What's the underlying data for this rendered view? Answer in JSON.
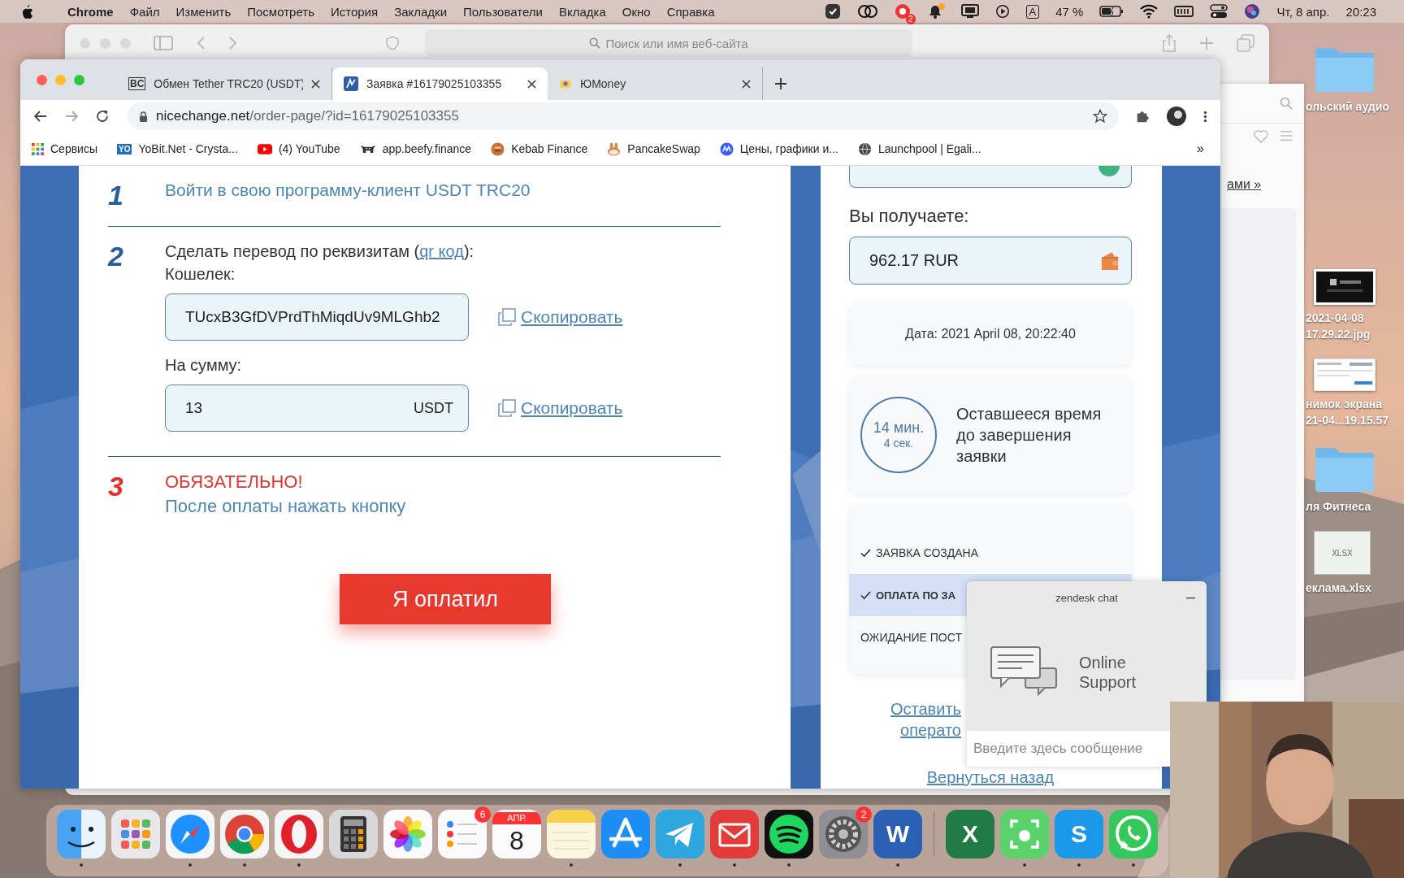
{
  "menu_bar": {
    "app": "Chrome",
    "menus": [
      "Файл",
      "Изменить",
      "Посмотреть",
      "История",
      "Закладки",
      "Пользователи",
      "Вкладка",
      "Окно",
      "Справка"
    ],
    "status_badge": "2",
    "input_source": "A",
    "battery": "47 %",
    "date": "Чт, 8 апр.",
    "time": "20:23"
  },
  "background_window": {
    "search_placeholder": "Поиск или имя веб-сайта"
  },
  "side_window": {
    "link": "ами »"
  },
  "desktop_icons": [
    {
      "kind": "folder",
      "lines": [
        "ольский аудио"
      ]
    },
    {
      "lines": [
        "2021-04-08",
        "17.29.22.jpg"
      ]
    },
    {
      "kind": "screenshot",
      "lines": [
        "нимок экрана",
        "21-04...19.15.57"
      ]
    },
    {
      "kind": "folder",
      "lines": [
        "ля Фитнеса"
      ]
    },
    {
      "kind": "spreadsheet",
      "tag": "XLSX",
      "lines": [
        "еклама.xlsx"
      ]
    }
  ],
  "browser": {
    "tabs": [
      {
        "title": "Обмен Tether TRC20 (USDT)",
        "favicon_text": "BC",
        "selected": false
      },
      {
        "title": "Заявка #16179025103355",
        "selected": true
      },
      {
        "title": "ЮMoney",
        "selected": false
      }
    ],
    "address": {
      "domain": "nicechange.net",
      "path": "/order-page/?id=16179025103355"
    },
    "bookmarks": [
      {
        "kind": "apps",
        "label": "Сервисы"
      },
      {
        "kind": "yobit",
        "icon_text": "YO",
        "label": "YoBit.Net - Crysta..."
      },
      {
        "kind": "video",
        "label": "(4) YouTube"
      },
      {
        "kind": "cow",
        "label": "app.beefy.finance"
      },
      {
        "kind": "kebab",
        "label": "Kebab Finance"
      },
      {
        "kind": "bunny",
        "label": "PancakeSwap"
      },
      {
        "kind": "chart",
        "label": "Цены, графики и..."
      },
      {
        "kind": "globe",
        "label": "Launchpool | Egali..."
      }
    ],
    "more": "»"
  },
  "order": {
    "steps": [
      {
        "number": "1",
        "kind": "link",
        "text": "Войти в свою программу-клиент USDT TRC20"
      },
      {
        "number": "2",
        "kind": "transfer",
        "text": "Сделать перевод по реквизитам (",
        "link": "qr код",
        "text_end": "):",
        "wallet_label": "Кошелек:",
        "wallet": "TUcxB3GfDVPrdThMiqdUv9MLGhb2",
        "copy": "Скопировать",
        "amount_label": "На сумму:",
        "amount": "13",
        "currency": "USDT",
        "amount_copy": "Скопировать"
      },
      {
        "number": "3",
        "kind": "notice",
        "title": "ОБЯЗАТЕЛЬНО!",
        "text": "После оплаты нажать кнопку"
      }
    ],
    "pay_button": "Я оплатил"
  },
  "summary": {
    "receive_label": "Вы получаете:",
    "receive": "962.17 RUR",
    "date": "Дата: 2021 April 08, 20:22:40",
    "timer": {
      "minutes": "14 мин.",
      "seconds": "4 сек.",
      "caption": "Оставшееся время до завершения заявки"
    },
    "statuses": [
      {
        "label": "ЗАЯВКА СОЗДАНА",
        "checked": true,
        "selected": false
      },
      {
        "label": "ОПЛАТА ПО ЗА",
        "checked": true,
        "selected": true
      },
      {
        "label": "ОЖИДАНИЕ ПОСТ",
        "checked": false,
        "selected": false
      }
    ],
    "operator_link": [
      "Оставить",
      "операто"
    ],
    "back_link": "Вернуться назад"
  },
  "chat": {
    "title": "zendesk chat",
    "minimize": "–",
    "heading": "Online Support",
    "placeholder": "Введите здесь сообщение"
  },
  "dock": [
    {
      "kind": "finder",
      "running": true
    },
    {
      "kind": "launchpad",
      "running": false
    },
    {
      "kind": "safari",
      "running": true
    },
    {
      "kind": "chrome",
      "running": true
    },
    {
      "kind": "opera",
      "running": true
    },
    {
      "kind": "calculator",
      "running": false
    },
    {
      "kind": "photos",
      "running": false
    },
    {
      "kind": "reminders",
      "badge": "6",
      "running": false
    },
    {
      "kind": "calendar",
      "month": "АПР.",
      "day": "8",
      "running": false
    },
    {
      "kind": "notes",
      "running": true
    },
    {
      "kind": "appstore",
      "running": false
    },
    {
      "kind": "telegram",
      "running": true
    },
    {
      "kind": "mail",
      "running": true
    },
    {
      "kind": "spotify",
      "running": true
    },
    {
      "kind": "settings",
      "badge": "2",
      "running": false
    },
    {
      "kind": "word",
      "letter": "W",
      "running": true
    },
    {
      "kind": "divider"
    },
    {
      "kind": "excel",
      "letter": "X",
      "running": false
    },
    {
      "kind": "screenshot",
      "running": true
    },
    {
      "kind": "skype",
      "letter": "S",
      "running": true
    },
    {
      "kind": "whatsapp",
      "running": true
    }
  ]
}
